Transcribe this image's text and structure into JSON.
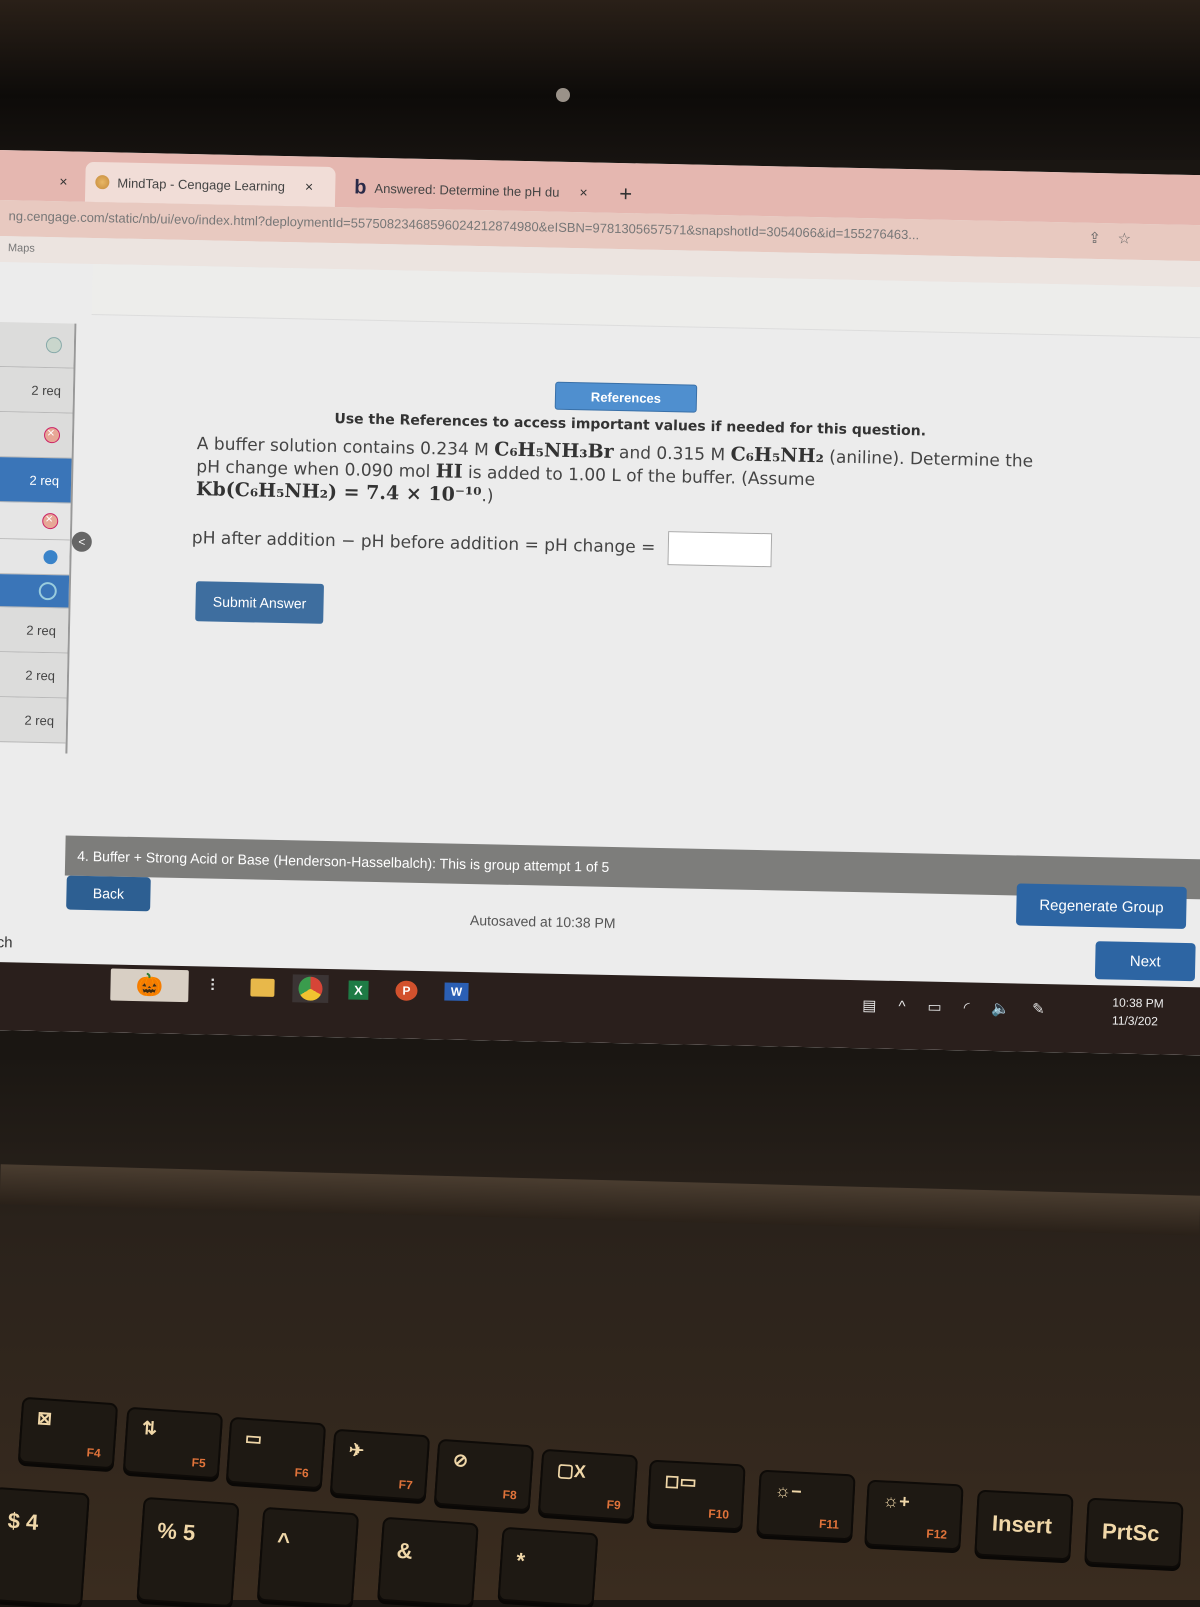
{
  "browser": {
    "tabs": [
      {
        "label": "MindTap - Cengage Learning",
        "active": true
      },
      {
        "label": "Answered: Determine the pH du",
        "active": false
      }
    ],
    "close_glyph": "×",
    "new_tab_glyph": "+",
    "url": "ng.cengage.com/static/nb/ui/evo/index.html?deploymentId=55750823468596024212874980&eISBN=9781305657571&snapshotId=3054066&id=155276463...",
    "bookmark": "Maps",
    "share_icon": "⇪",
    "star_icon": "☆"
  },
  "sidebar": {
    "items": [
      {
        "type": "icon",
        "status": "ok"
      },
      {
        "type": "label",
        "label": "2 req"
      },
      {
        "type": "icon",
        "status": "incorrect"
      },
      {
        "type": "label",
        "label": "2 req",
        "selected": true
      },
      {
        "type": "icon",
        "status": "incorrect"
      },
      {
        "type": "icon",
        "status": "in-progress"
      },
      {
        "type": "icon",
        "status": "current",
        "selected": true
      },
      {
        "type": "label",
        "label": "2 req"
      },
      {
        "type": "label",
        "label": "2 req"
      },
      {
        "type": "label",
        "label": "2 req"
      }
    ],
    "collapse_glyph": "<"
  },
  "question": {
    "references_button": "References",
    "references_note": "Use the References to access important values if needed for this question.",
    "text_1": "A buffer solution contains 0.234 M ",
    "acid_formula": "C₆H₅NH₃Br",
    "text_2": " and 0.315 M ",
    "base_formula": "C₆H₅NH₂",
    "text_3": " (aniline). Determine the pH change when 0.090 mol ",
    "strong_acid": "HI",
    "text_4": " is added to 1.00 L of the buffer. (Assume ",
    "kb_expression": "Kb(C₆H₅NH₂) = 7.4 × 10⁻¹⁰",
    "text_5": ".)",
    "answer_label": "pH after addition − pH before addition = pH change =",
    "answer_value": "",
    "submit_button": "Submit Answer"
  },
  "footer": {
    "group_title": "4. Buffer + Strong Acid or Base (Henderson-Hasselbalch): This is group attempt 1 of 5",
    "back_button": "Back",
    "autosave_text": "Autosaved at 10:38 PM",
    "regenerate_button": "Regenerate Group",
    "next_button": "Next",
    "search_partial": "arch"
  },
  "taskbar": {
    "apps": [
      "task-view",
      "file-explorer",
      "chrome",
      "excel",
      "powerpoint",
      "word"
    ],
    "excel_letter": "X",
    "ppt_letter": "P",
    "word_letter": "W",
    "tray_icons": [
      "news",
      "chevron-up",
      "battery",
      "wifi",
      "volume",
      "pen"
    ],
    "time": "10:38 PM",
    "date": "11/3/202"
  },
  "keyboard": {
    "function_keys": [
      {
        "fn": "F4",
        "glyph": "⊠"
      },
      {
        "fn": "F5",
        "glyph": "⇅"
      },
      {
        "fn": "F6",
        "glyph": "▭"
      },
      {
        "fn": "F7",
        "glyph": "✈"
      },
      {
        "fn": "F8",
        "glyph": "⊘"
      },
      {
        "fn": "F9",
        "glyph": "▢X"
      },
      {
        "fn": "F10",
        "glyph": "◻▭"
      },
      {
        "fn": "F11",
        "glyph": "☼−"
      },
      {
        "fn": "F12",
        "glyph": "☼+"
      },
      {
        "fn": "",
        "label": "Insert"
      },
      {
        "fn": "",
        "label": "PrtSc"
      }
    ],
    "number_keys": [
      "$ 4",
      "% 5",
      "^",
      "&",
      "*"
    ]
  }
}
